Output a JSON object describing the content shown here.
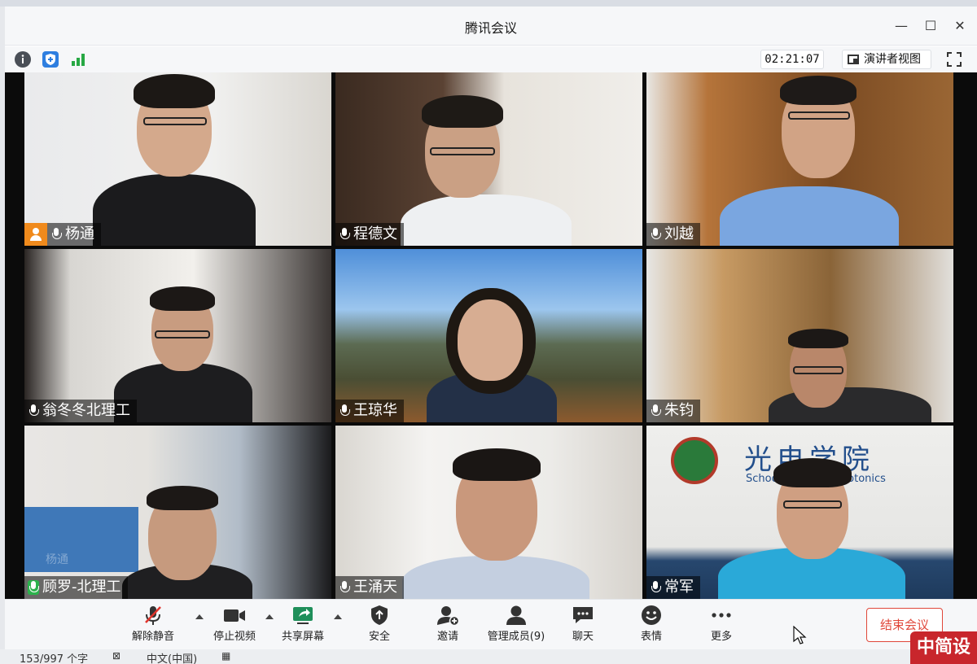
{
  "window": {
    "title": "腾讯会议",
    "controls": {
      "minimize": "—",
      "maximize": "☐",
      "close": "✕"
    }
  },
  "toolbar": {
    "timer": "02:21:07",
    "speaker_view_label": "演讲者视图",
    "icons": [
      "info-icon",
      "shield-icon",
      "signal-icon",
      "fullscreen-icon"
    ]
  },
  "participants": [
    {
      "name": "杨通",
      "mic": "muted",
      "host": true
    },
    {
      "name": "程德文",
      "mic": "on",
      "host": false
    },
    {
      "name": "刘越",
      "mic": "on",
      "host": false
    },
    {
      "name": "翁冬冬北理工",
      "mic": "muted",
      "host": false
    },
    {
      "name": "王琼华",
      "mic": "on",
      "host": false
    },
    {
      "name": "朱钧",
      "mic": "on",
      "host": false
    },
    {
      "name": "顾罗-北理工",
      "mic": "active",
      "host": false
    },
    {
      "name": "王涌天",
      "mic": "on",
      "host": false
    },
    {
      "name": "常军",
      "mic": "muted",
      "host": false
    }
  ],
  "tile_texts": {
    "ghost_name": "杨通",
    "wall_sign": "光电学院",
    "wall_sign_sub": "School of ... and Photonics"
  },
  "controls": {
    "unmute": "解除静音",
    "stop_video": "停止视频",
    "share_screen": "共享屏幕",
    "security": "安全",
    "invite": "邀请",
    "manage_members": "管理成员(9)",
    "chat": "聊天",
    "reactions": "表情",
    "more": "更多",
    "end_meeting": "结束会议"
  },
  "statusbar": {
    "word_count": "153/997 个字",
    "language": "中文(中国)"
  },
  "ime_badge": "中简设",
  "colors": {
    "accent_orange": "#f08a1c",
    "end_red": "#e0473a",
    "active_mic_green": "#2bb24c",
    "muted_red": "#e0342c"
  }
}
